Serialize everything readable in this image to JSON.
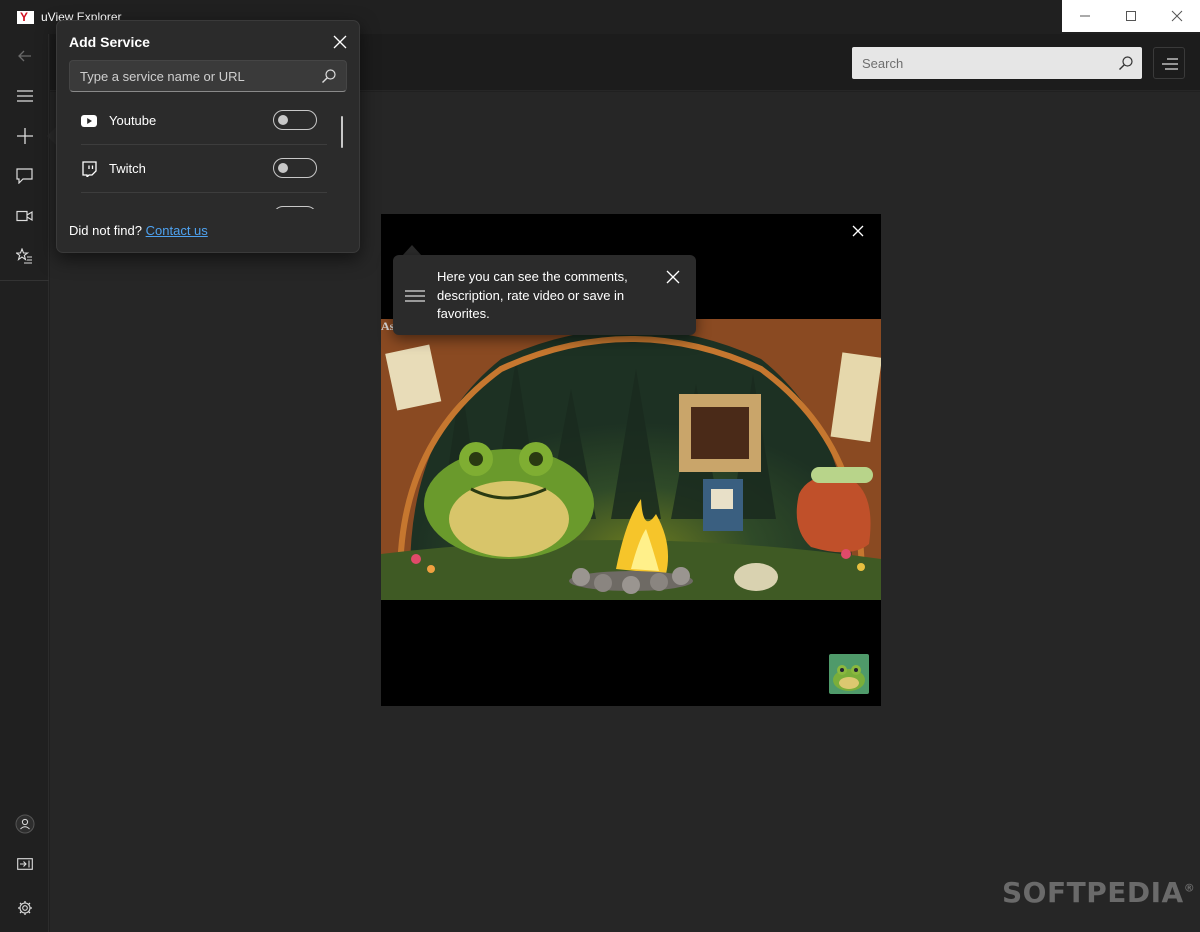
{
  "app": {
    "title": "uView Explorer"
  },
  "header": {
    "search_placeholder": "Search"
  },
  "flyout": {
    "title": "Add Service",
    "search_placeholder": "Type a service name or URL",
    "services": [
      {
        "name": "Youtube",
        "icon": "youtube-icon",
        "enabled": false
      },
      {
        "name": "Twitch",
        "icon": "twitch-icon",
        "enabled": false
      }
    ],
    "footer_text": "Did not find?",
    "footer_link": "Contact us"
  },
  "tip": {
    "text": "Here you can see the comments, description, rate video or save in favorites."
  },
  "video": {
    "label": "As"
  },
  "watermark": {
    "text": "SOFTPEDIA",
    "mark": "®"
  },
  "colors": {
    "background": "#202020",
    "panel": "#2b2b2b",
    "link": "#4ea2f0",
    "brand": "#d01020"
  }
}
